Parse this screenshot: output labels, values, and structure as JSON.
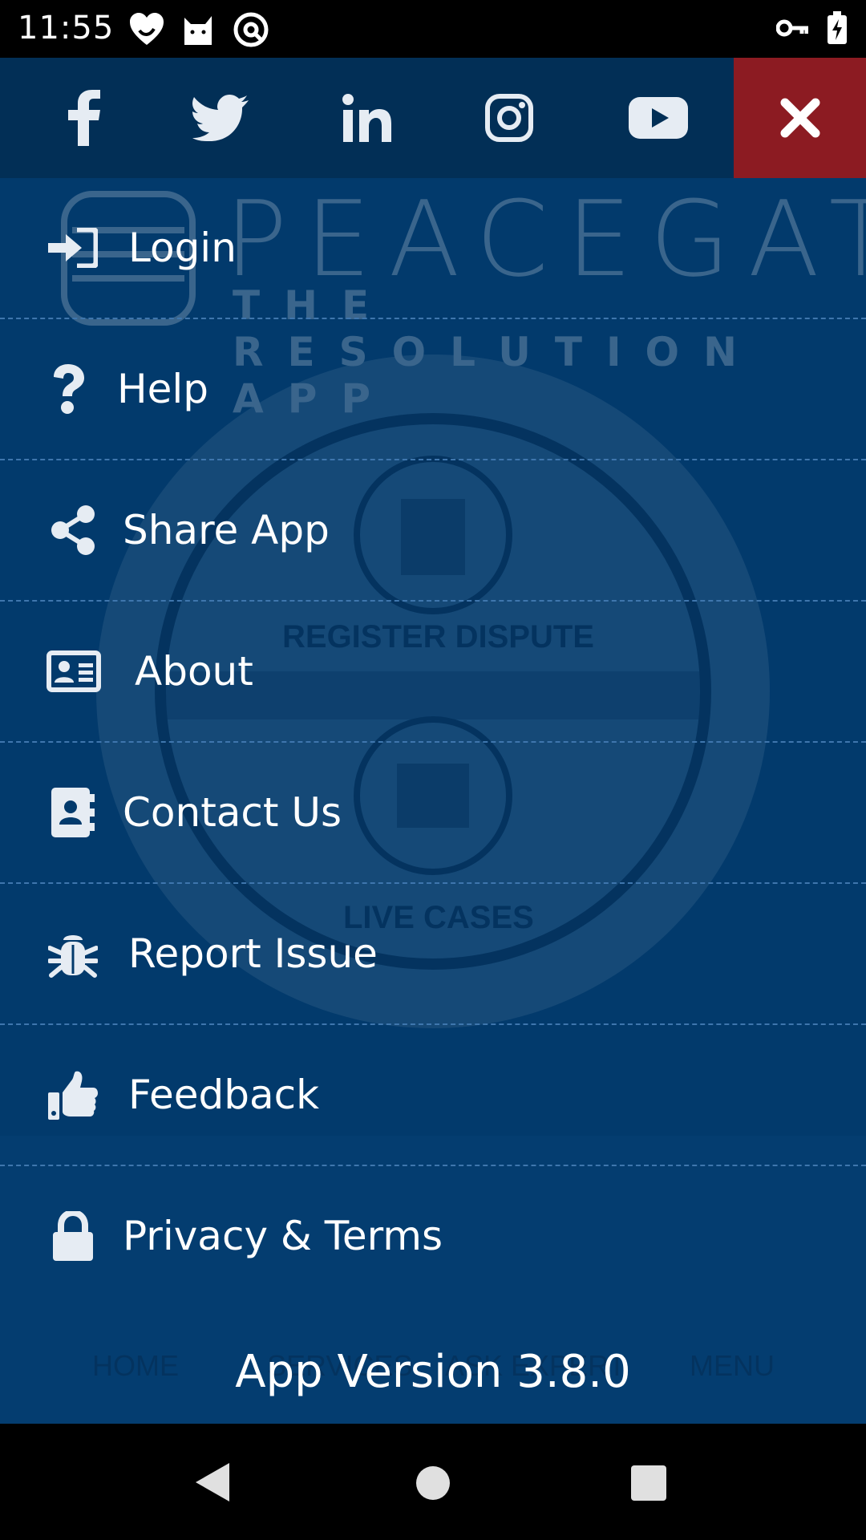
{
  "status_bar": {
    "time": "11:55",
    "left_icons": [
      "heart-app-icon",
      "cat-app-icon",
      "at-sign-icon"
    ],
    "right_icons": [
      "key-icon",
      "battery-charging-icon"
    ]
  },
  "social": {
    "icons": [
      "facebook-icon",
      "twitter-icon",
      "linkedin-icon",
      "instagram-icon",
      "youtube-icon"
    ],
    "close_icon": "close-icon",
    "close_bg": "#8c1b22"
  },
  "background": {
    "logo_text": "PEACEGATE",
    "tagline": "THE RESOLUTION APP",
    "register_label": "REGISTER DISPUTE",
    "live_cases_label": "LIVE CASES",
    "nav_labels": [
      "HOME",
      "SERVICES",
      "ASK EXPERT",
      "MENU"
    ]
  },
  "menu": {
    "items": [
      {
        "label": "Login",
        "icon": "login-icon"
      },
      {
        "label": "Help",
        "icon": "question-icon"
      },
      {
        "label": "Share App",
        "icon": "share-icon"
      },
      {
        "label": "About",
        "icon": "id-card-icon"
      },
      {
        "label": "Contact Us",
        "icon": "address-book-icon"
      },
      {
        "label": "Report Issue",
        "icon": "bug-icon"
      },
      {
        "label": "Feedback",
        "icon": "thumbs-up-icon"
      },
      {
        "label": "Privacy & Terms",
        "icon": "lock-icon"
      }
    ],
    "version": "App Version 3.8.0"
  },
  "colors": {
    "menu_bg": "#023a6c",
    "header_bg": "#022f56",
    "divider": "#3f76ad"
  }
}
